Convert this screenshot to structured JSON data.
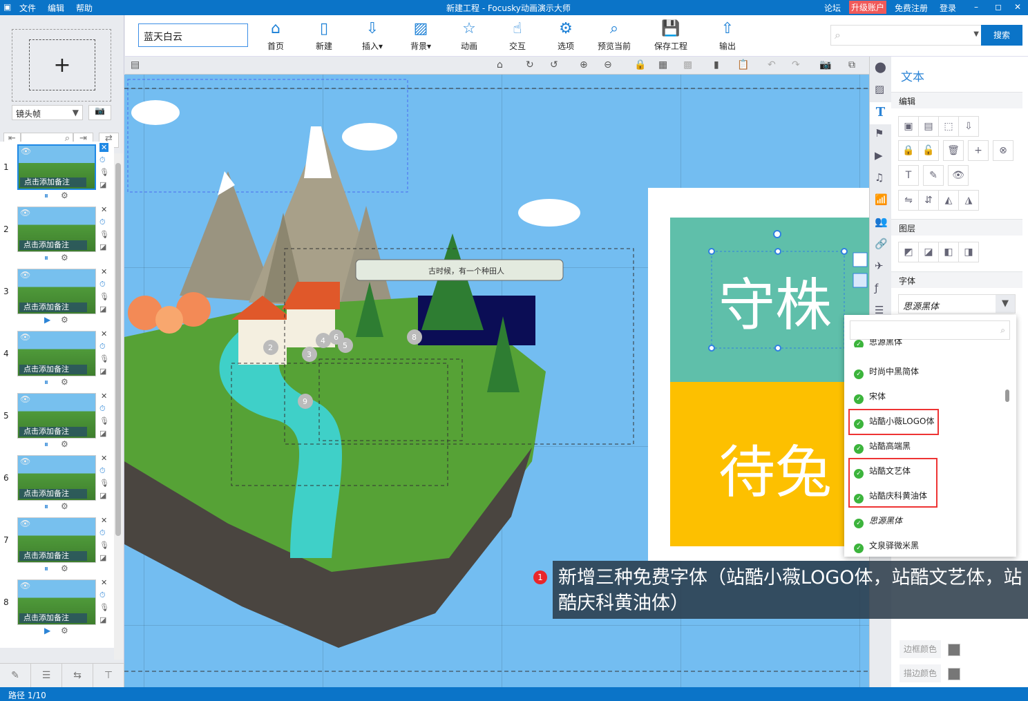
{
  "titlebar": {
    "menu": [
      "文件",
      "编辑",
      "帮助"
    ],
    "title": "新建工程 - Focusky动画演示大师",
    "links": [
      "论坛",
      "升级账户",
      "免费注册",
      "登录"
    ]
  },
  "left": {
    "add": "+",
    "frame_select": "镜头帧",
    "thumbs": [
      {
        "num": "1",
        "note": "点击添加备注",
        "play": "pause"
      },
      {
        "num": "2",
        "note": "点击添加备注",
        "play": "pause"
      },
      {
        "num": "3",
        "note": "点击添加备注",
        "play": "play"
      },
      {
        "num": "4",
        "note": "点击添加备注",
        "play": "pause"
      },
      {
        "num": "5",
        "note": "点击添加备注",
        "play": "pause"
      },
      {
        "num": "6",
        "note": "点击添加备注",
        "play": "pause"
      },
      {
        "num": "7",
        "note": "点击添加备注",
        "play": "pause"
      },
      {
        "num": "8",
        "note": "点击添加备注",
        "play": "play"
      }
    ]
  },
  "toolbar": {
    "title_value": "蓝天白云",
    "buttons": [
      {
        "label": "首页",
        "icon": "home-icon",
        "g": "⌂"
      },
      {
        "label": "新建",
        "icon": "new-icon",
        "g": "▯"
      },
      {
        "label": "插入▾",
        "icon": "insert-icon",
        "g": "⇩"
      },
      {
        "label": "背景▾",
        "icon": "background-icon",
        "g": "▨"
      },
      {
        "label": "动画",
        "icon": "animation-icon",
        "g": "☆"
      },
      {
        "label": "交互",
        "icon": "interact-icon",
        "g": "☝"
      },
      {
        "label": "选项",
        "icon": "options-icon",
        "g": "⚙"
      },
      {
        "label": "预览当前",
        "icon": "preview-icon",
        "g": "⌕"
      },
      {
        "label": "保存工程",
        "icon": "save-icon",
        "g": "💾"
      },
      {
        "label": "输出",
        "icon": "export-icon",
        "g": "⇧"
      }
    ],
    "search_button": "搜索"
  },
  "canvas": {
    "scroll_text": "古时候，有一个种田人",
    "slide_top": "守株",
    "slide_bottom": "待兔",
    "markers": [
      "2",
      "3",
      "4",
      "5",
      "6",
      "8",
      "9"
    ]
  },
  "right": {
    "title": "文本",
    "sections": {
      "edit": "编辑",
      "layer": "图层",
      "font": "字体"
    },
    "font_value": "思源黑体",
    "border_color": "边框颜色",
    "stroke_color": "描边颜色"
  },
  "fontlist": {
    "items": [
      "思源黑体",
      "时尚中黑简体",
      "宋体",
      "站酷小薇LOGO体",
      "站酷高端黑",
      "站酷文艺体",
      "站酷庆科黄油体",
      "思源黑体",
      "文泉驿微米黑"
    ]
  },
  "tip": {
    "num": "1",
    "text": "新增三种免费字体（站酷小薇LOGO体，站酷文艺体，站酷庆科黄油体）"
  },
  "status": {
    "path": "路径 1/10"
  },
  "colors": {
    "accent": "#0b74c8",
    "upgrade": "#f05a5a",
    "canvas": "#73bdf1",
    "teal": "#5fbfaa",
    "yellow": "#fdc000",
    "highlight": "#ee3333"
  }
}
